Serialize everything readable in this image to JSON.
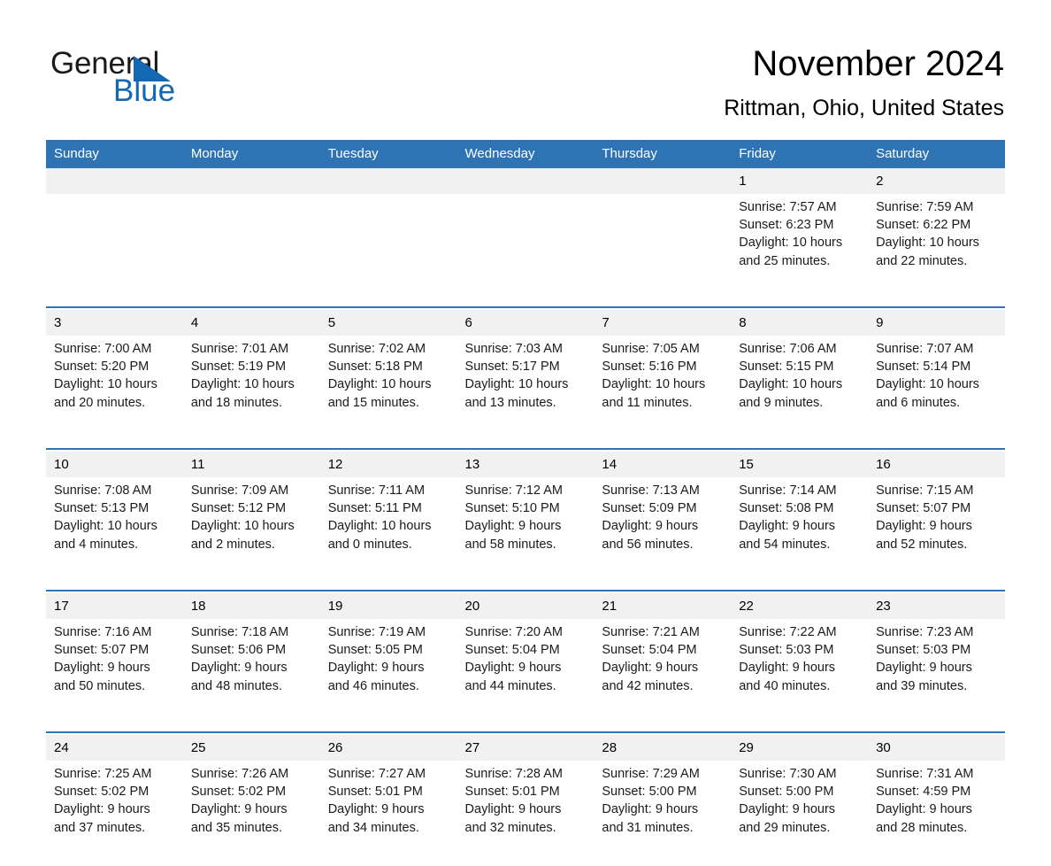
{
  "brand": {
    "name_part1": "General",
    "name_part2": "Blue",
    "triangle_icon": "triangle-icon",
    "accent_color": "#1268b3"
  },
  "header": {
    "title": "November 2024",
    "subtitle": "Rittman, Ohio, United States"
  },
  "theme": {
    "header_blue": "#2e74b5",
    "date_band_gray": "#f1f1f1",
    "body_white": "#ffffff",
    "text_black": "#000000"
  },
  "calendar": {
    "weekday_headers": [
      "Sunday",
      "Monday",
      "Tuesday",
      "Wednesday",
      "Thursday",
      "Friday",
      "Saturday"
    ],
    "weeks": [
      [
        {
          "day": "",
          "sunrise": "",
          "sunset": "",
          "daylight_line1": "",
          "daylight_line2": ""
        },
        {
          "day": "",
          "sunrise": "",
          "sunset": "",
          "daylight_line1": "",
          "daylight_line2": ""
        },
        {
          "day": "",
          "sunrise": "",
          "sunset": "",
          "daylight_line1": "",
          "daylight_line2": ""
        },
        {
          "day": "",
          "sunrise": "",
          "sunset": "",
          "daylight_line1": "",
          "daylight_line2": ""
        },
        {
          "day": "",
          "sunrise": "",
          "sunset": "",
          "daylight_line1": "",
          "daylight_line2": ""
        },
        {
          "day": "1",
          "sunrise": "Sunrise: 7:57 AM",
          "sunset": "Sunset: 6:23 PM",
          "daylight_line1": "Daylight: 10 hours",
          "daylight_line2": "and 25 minutes."
        },
        {
          "day": "2",
          "sunrise": "Sunrise: 7:59 AM",
          "sunset": "Sunset: 6:22 PM",
          "daylight_line1": "Daylight: 10 hours",
          "daylight_line2": "and 22 minutes."
        }
      ],
      [
        {
          "day": "3",
          "sunrise": "Sunrise: 7:00 AM",
          "sunset": "Sunset: 5:20 PM",
          "daylight_line1": "Daylight: 10 hours",
          "daylight_line2": "and 20 minutes."
        },
        {
          "day": "4",
          "sunrise": "Sunrise: 7:01 AM",
          "sunset": "Sunset: 5:19 PM",
          "daylight_line1": "Daylight: 10 hours",
          "daylight_line2": "and 18 minutes."
        },
        {
          "day": "5",
          "sunrise": "Sunrise: 7:02 AM",
          "sunset": "Sunset: 5:18 PM",
          "daylight_line1": "Daylight: 10 hours",
          "daylight_line2": "and 15 minutes."
        },
        {
          "day": "6",
          "sunrise": "Sunrise: 7:03 AM",
          "sunset": "Sunset: 5:17 PM",
          "daylight_line1": "Daylight: 10 hours",
          "daylight_line2": "and 13 minutes."
        },
        {
          "day": "7",
          "sunrise": "Sunrise: 7:05 AM",
          "sunset": "Sunset: 5:16 PM",
          "daylight_line1": "Daylight: 10 hours",
          "daylight_line2": "and 11 minutes."
        },
        {
          "day": "8",
          "sunrise": "Sunrise: 7:06 AM",
          "sunset": "Sunset: 5:15 PM",
          "daylight_line1": "Daylight: 10 hours",
          "daylight_line2": "and 9 minutes."
        },
        {
          "day": "9",
          "sunrise": "Sunrise: 7:07 AM",
          "sunset": "Sunset: 5:14 PM",
          "daylight_line1": "Daylight: 10 hours",
          "daylight_line2": "and 6 minutes."
        }
      ],
      [
        {
          "day": "10",
          "sunrise": "Sunrise: 7:08 AM",
          "sunset": "Sunset: 5:13 PM",
          "daylight_line1": "Daylight: 10 hours",
          "daylight_line2": "and 4 minutes."
        },
        {
          "day": "11",
          "sunrise": "Sunrise: 7:09 AM",
          "sunset": "Sunset: 5:12 PM",
          "daylight_line1": "Daylight: 10 hours",
          "daylight_line2": "and 2 minutes."
        },
        {
          "day": "12",
          "sunrise": "Sunrise: 7:11 AM",
          "sunset": "Sunset: 5:11 PM",
          "daylight_line1": "Daylight: 10 hours",
          "daylight_line2": "and 0 minutes."
        },
        {
          "day": "13",
          "sunrise": "Sunrise: 7:12 AM",
          "sunset": "Sunset: 5:10 PM",
          "daylight_line1": "Daylight: 9 hours",
          "daylight_line2": "and 58 minutes."
        },
        {
          "day": "14",
          "sunrise": "Sunrise: 7:13 AM",
          "sunset": "Sunset: 5:09 PM",
          "daylight_line1": "Daylight: 9 hours",
          "daylight_line2": "and 56 minutes."
        },
        {
          "day": "15",
          "sunrise": "Sunrise: 7:14 AM",
          "sunset": "Sunset: 5:08 PM",
          "daylight_line1": "Daylight: 9 hours",
          "daylight_line2": "and 54 minutes."
        },
        {
          "day": "16",
          "sunrise": "Sunrise: 7:15 AM",
          "sunset": "Sunset: 5:07 PM",
          "daylight_line1": "Daylight: 9 hours",
          "daylight_line2": "and 52 minutes."
        }
      ],
      [
        {
          "day": "17",
          "sunrise": "Sunrise: 7:16 AM",
          "sunset": "Sunset: 5:07 PM",
          "daylight_line1": "Daylight: 9 hours",
          "daylight_line2": "and 50 minutes."
        },
        {
          "day": "18",
          "sunrise": "Sunrise: 7:18 AM",
          "sunset": "Sunset: 5:06 PM",
          "daylight_line1": "Daylight: 9 hours",
          "daylight_line2": "and 48 minutes."
        },
        {
          "day": "19",
          "sunrise": "Sunrise: 7:19 AM",
          "sunset": "Sunset: 5:05 PM",
          "daylight_line1": "Daylight: 9 hours",
          "daylight_line2": "and 46 minutes."
        },
        {
          "day": "20",
          "sunrise": "Sunrise: 7:20 AM",
          "sunset": "Sunset: 5:04 PM",
          "daylight_line1": "Daylight: 9 hours",
          "daylight_line2": "and 44 minutes."
        },
        {
          "day": "21",
          "sunrise": "Sunrise: 7:21 AM",
          "sunset": "Sunset: 5:04 PM",
          "daylight_line1": "Daylight: 9 hours",
          "daylight_line2": "and 42 minutes."
        },
        {
          "day": "22",
          "sunrise": "Sunrise: 7:22 AM",
          "sunset": "Sunset: 5:03 PM",
          "daylight_line1": "Daylight: 9 hours",
          "daylight_line2": "and 40 minutes."
        },
        {
          "day": "23",
          "sunrise": "Sunrise: 7:23 AM",
          "sunset": "Sunset: 5:03 PM",
          "daylight_line1": "Daylight: 9 hours",
          "daylight_line2": "and 39 minutes."
        }
      ],
      [
        {
          "day": "24",
          "sunrise": "Sunrise: 7:25 AM",
          "sunset": "Sunset: 5:02 PM",
          "daylight_line1": "Daylight: 9 hours",
          "daylight_line2": "and 37 minutes."
        },
        {
          "day": "25",
          "sunrise": "Sunrise: 7:26 AM",
          "sunset": "Sunset: 5:02 PM",
          "daylight_line1": "Daylight: 9 hours",
          "daylight_line2": "and 35 minutes."
        },
        {
          "day": "26",
          "sunrise": "Sunrise: 7:27 AM",
          "sunset": "Sunset: 5:01 PM",
          "daylight_line1": "Daylight: 9 hours",
          "daylight_line2": "and 34 minutes."
        },
        {
          "day": "27",
          "sunrise": "Sunrise: 7:28 AM",
          "sunset": "Sunset: 5:01 PM",
          "daylight_line1": "Daylight: 9 hours",
          "daylight_line2": "and 32 minutes."
        },
        {
          "day": "28",
          "sunrise": "Sunrise: 7:29 AM",
          "sunset": "Sunset: 5:00 PM",
          "daylight_line1": "Daylight: 9 hours",
          "daylight_line2": "and 31 minutes."
        },
        {
          "day": "29",
          "sunrise": "Sunrise: 7:30 AM",
          "sunset": "Sunset: 5:00 PM",
          "daylight_line1": "Daylight: 9 hours",
          "daylight_line2": "and 29 minutes."
        },
        {
          "day": "30",
          "sunrise": "Sunrise: 7:31 AM",
          "sunset": "Sunset: 4:59 PM",
          "daylight_line1": "Daylight: 9 hours",
          "daylight_line2": "and 28 minutes."
        }
      ]
    ]
  }
}
